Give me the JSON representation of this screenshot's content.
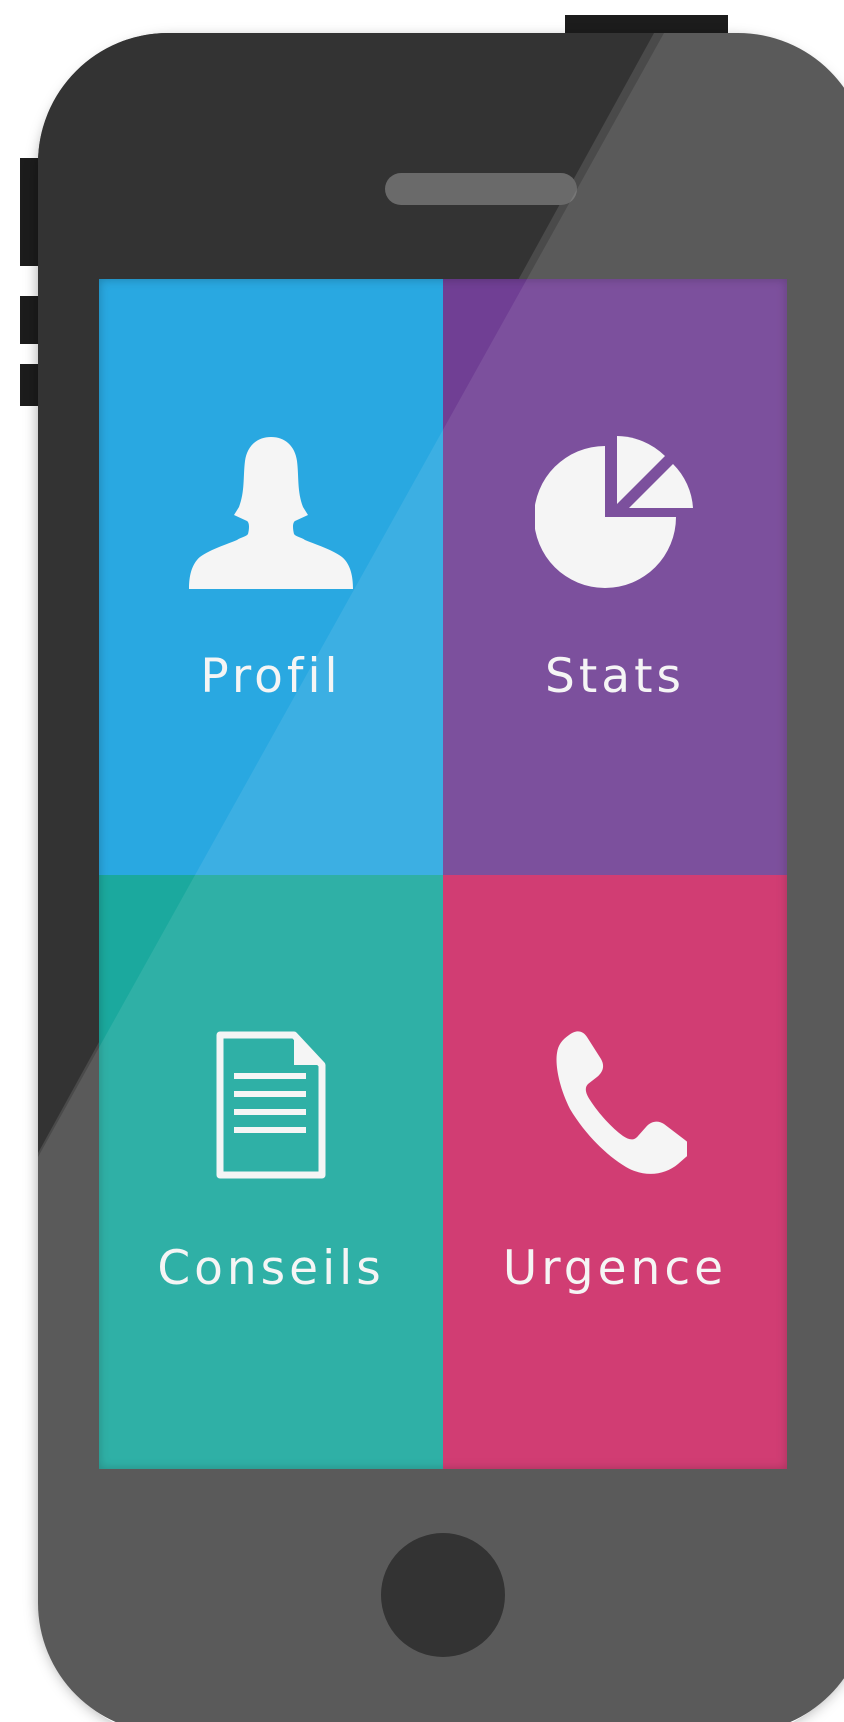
{
  "tiles": {
    "profil": {
      "label": "Profil",
      "color": "#29a8e1",
      "icon": "user-icon"
    },
    "stats": {
      "label": "Stats",
      "color": "#703f94",
      "icon": "pie-chart-icon"
    },
    "conseils": {
      "label": "Conseils",
      "color": "#1ba99e",
      "icon": "document-icon"
    },
    "urgence": {
      "label": "Urgence",
      "color": "#cd2a66",
      "icon": "phone-icon"
    }
  },
  "device": {
    "body_color": "#4a4a4a",
    "bezel_dark_color": "#333333"
  }
}
